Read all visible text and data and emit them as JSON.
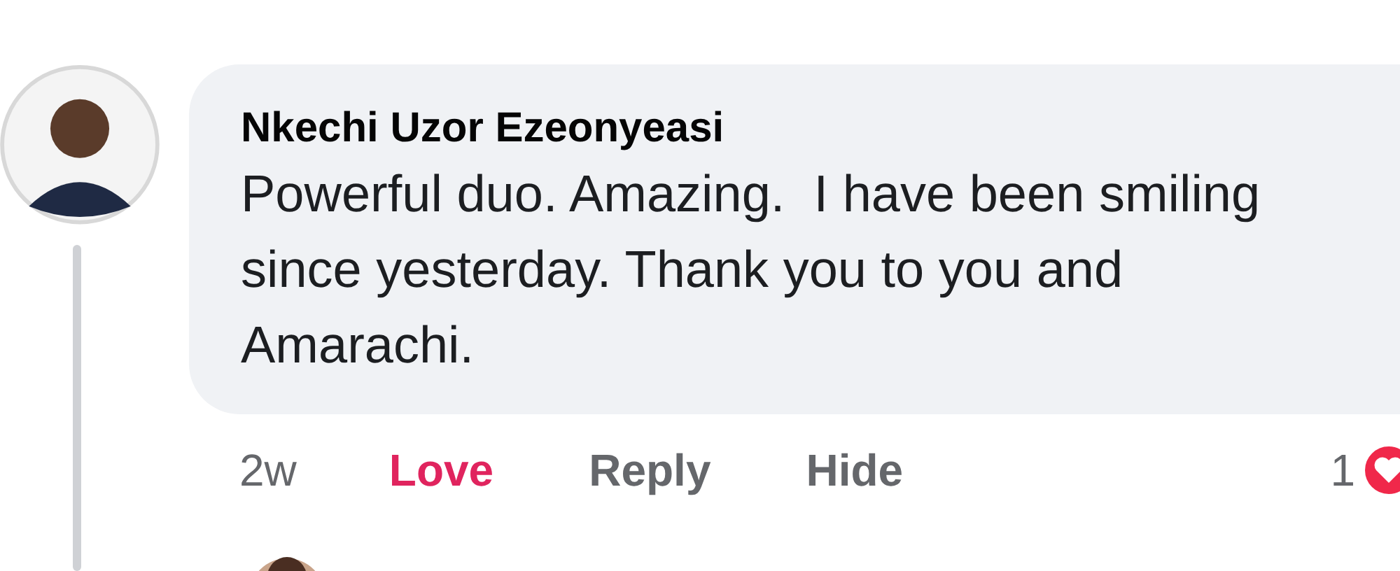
{
  "comment": {
    "author": "Nkechi Uzor Ezeonyeasi",
    "text": "Powerful duo. Amazing.  I have been smiling since yesterday. Thank you to you and Amarachi.",
    "time": "2w",
    "actions": [
      {
        "kind": "react",
        "label": "Love",
        "selected": true
      },
      {
        "kind": "reply",
        "label": "Reply"
      },
      {
        "kind": "hide",
        "label": "Hide"
      }
    ],
    "reaction_count": "1"
  }
}
